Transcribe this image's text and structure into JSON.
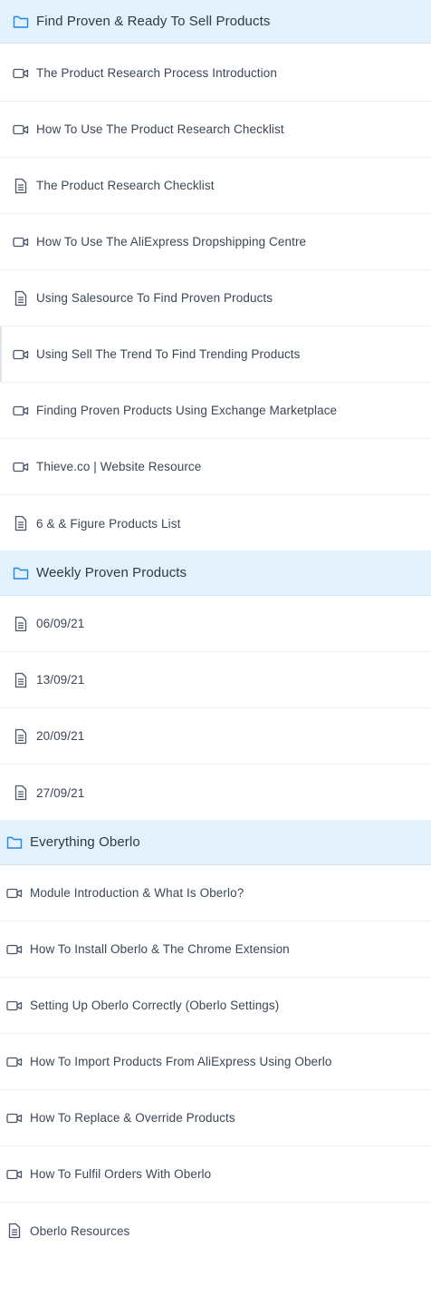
{
  "sections": [
    {
      "title": "Find Proven & Ready To Sell Products",
      "icon": "folder-icon",
      "accent": "#1e88e5",
      "items": [
        {
          "label": "The Product Research Process Introduction",
          "type": "video"
        },
        {
          "label": "How To Use The Product Research Checklist",
          "type": "video"
        },
        {
          "label": "The Product Research Checklist",
          "type": "document"
        },
        {
          "label": "How To Use The AliExpress Dropshipping Centre",
          "type": "video"
        },
        {
          "label": "Using Salesource To Find Proven Products",
          "type": "document"
        },
        {
          "label": "Using Sell The Trend To Find Trending Products",
          "type": "video"
        },
        {
          "label": "Finding Proven Products Using Exchange Marketplace",
          "type": "video"
        },
        {
          "label": "Thieve.co | Website Resource",
          "type": "video"
        },
        {
          "label": "6 & & Figure Products List",
          "type": "document"
        }
      ]
    },
    {
      "title": "Weekly Proven Products",
      "icon": "folder-icon",
      "accent": "#1e88e5",
      "items": [
        {
          "label": "06/09/21",
          "type": "document"
        },
        {
          "label": "13/09/21",
          "type": "document"
        },
        {
          "label": "20/09/21",
          "type": "document"
        },
        {
          "label": "27/09/21",
          "type": "document"
        }
      ]
    },
    {
      "title": "Everything Oberlo",
      "icon": "folder-icon",
      "accent": "#1e88e5",
      "items": [
        {
          "label": "Module Introduction & What Is Oberlo?",
          "type": "video"
        },
        {
          "label": "How To Install Oberlo & The Chrome Extension",
          "type": "video"
        },
        {
          "label": "Setting Up Oberlo Correctly (Oberlo Settings)",
          "type": "video"
        },
        {
          "label": "How To Import Products From AliExpress Using Oberlo",
          "type": "video"
        },
        {
          "label": "How To Replace & Override Products",
          "type": "video"
        },
        {
          "label": "How To Fulfil Orders With Oberlo",
          "type": "video"
        },
        {
          "label": "Oberlo Resources",
          "type": "document"
        }
      ]
    }
  ],
  "colors": {
    "section_bg": "#e2f1fb",
    "folder_icon": "#1e88e5",
    "item_icon": "#4a5566",
    "divider": "#eef1f4"
  }
}
